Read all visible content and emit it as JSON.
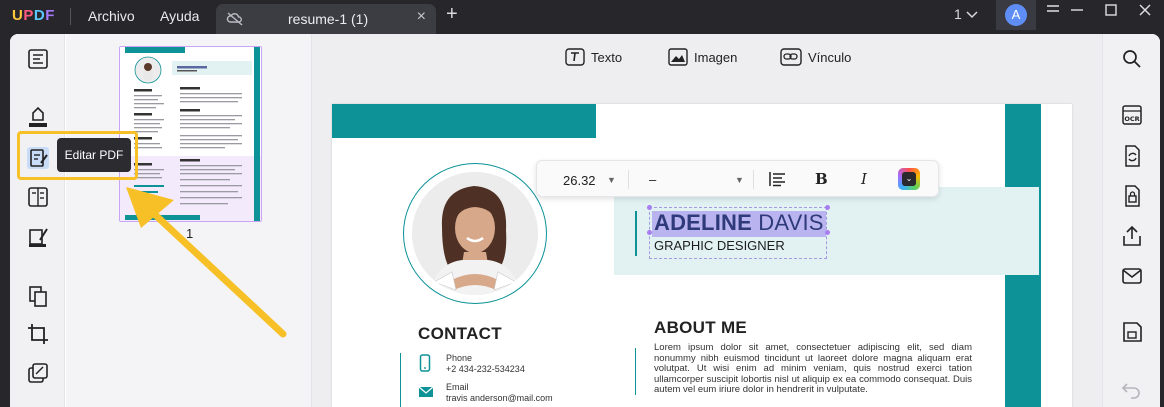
{
  "app": {
    "logo": "UPDF",
    "menus": [
      "Archivo",
      "Ayuda"
    ],
    "tab_title": "resume-1 (1)",
    "page_indicator": "1",
    "avatar_letter": "A"
  },
  "left_toolbar": {
    "tooltip": "Editar PDF"
  },
  "thumbnails": {
    "page_number": "1"
  },
  "doc_toolbar": {
    "text_label": "Texto",
    "image_label": "Imagen",
    "link_label": "Vínculo"
  },
  "format_toolbar": {
    "font_size": "26.32",
    "font_family": "–",
    "bold_label": "B",
    "italic_label": "I"
  },
  "resume": {
    "name_first": "ADELINE",
    "name_last": "DAVIS",
    "job_title": "GRAPHIC DESIGNER",
    "contact_heading": "CONTACT",
    "phone_label": "Phone",
    "phone_value": "+2 434-232-534234",
    "email_label": "Email",
    "email_value": "travis anderson@mail.com",
    "about_heading": "ABOUT ME",
    "about_text": "Lorem ipsum dolor sit amet, consectetuer adipiscing elit, sed diam nonummy nibh euismod tincidunt ut laoreet dolore magna aliquam erat volutpat. Ut wisi enim ad minim veniam, quis nostrud exerci tation ullamcorper suscipit lobortis nisl ut aliquip ex ea commodo consequat. Duis autem vel eum iriure dolor in hendrerit in vulputate."
  },
  "colors": {
    "accent_teal": "#0c9297",
    "highlight_yellow": "#f6c026",
    "selection_purple": "#a67ef0"
  }
}
